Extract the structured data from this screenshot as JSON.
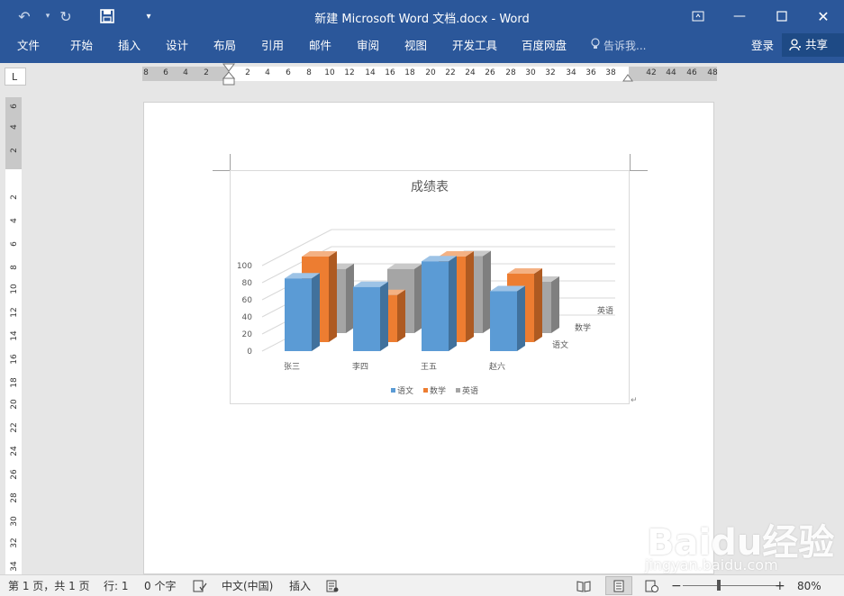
{
  "window": {
    "title": "新建 Microsoft Word 文档.docx - Word"
  },
  "ribbon": {
    "tabs": [
      "文件",
      "开始",
      "插入",
      "设计",
      "布局",
      "引用",
      "邮件",
      "审阅",
      "视图",
      "开发工具",
      "百度网盘"
    ],
    "tell_me": "告诉我...",
    "login": "登录",
    "share": "共享"
  },
  "ruler": {
    "corner": "L",
    "h_labels": [
      "8",
      "6",
      "4",
      "2",
      "2",
      "4",
      "6",
      "8",
      "10",
      "12",
      "14",
      "16",
      "18",
      "20",
      "22",
      "24",
      "26",
      "28",
      "30",
      "32",
      "34",
      "36",
      "38",
      "42",
      "44",
      "46",
      "48"
    ],
    "v_labels": [
      "6",
      "4",
      "2",
      "2",
      "4",
      "6",
      "8",
      "10",
      "12",
      "14",
      "16",
      "18",
      "20",
      "22",
      "24",
      "26",
      "28",
      "30",
      "32",
      "34"
    ]
  },
  "chart_data": {
    "type": "bar3d",
    "title": "成绩表",
    "categories": [
      "张三",
      "李四",
      "王五",
      "赵六"
    ],
    "depth_labels": [
      "语文",
      "数学",
      "英语"
    ],
    "yticks": [
      "0",
      "20",
      "40",
      "60",
      "80",
      "100"
    ],
    "ylim": [
      0,
      100
    ],
    "series": [
      {
        "name": "语文",
        "color": "#5b9bd5",
        "values": [
          85,
          75,
          105,
          70
        ]
      },
      {
        "name": "数学",
        "color": "#ed7d31",
        "values": [
          100,
          55,
          100,
          80
        ]
      },
      {
        "name": "英语",
        "color": "#a5a5a5",
        "values": [
          75,
          75,
          90,
          60
        ]
      }
    ],
    "legend": "bottom"
  },
  "status": {
    "page": "第 1 页，共 1 页",
    "line": "行: 1",
    "words": "0 个字",
    "language": "中文(中国)",
    "mode": "插入",
    "zoom": "80%"
  },
  "watermark": {
    "brand": "Baidu经验",
    "url": "jingyan.baidu.com"
  }
}
